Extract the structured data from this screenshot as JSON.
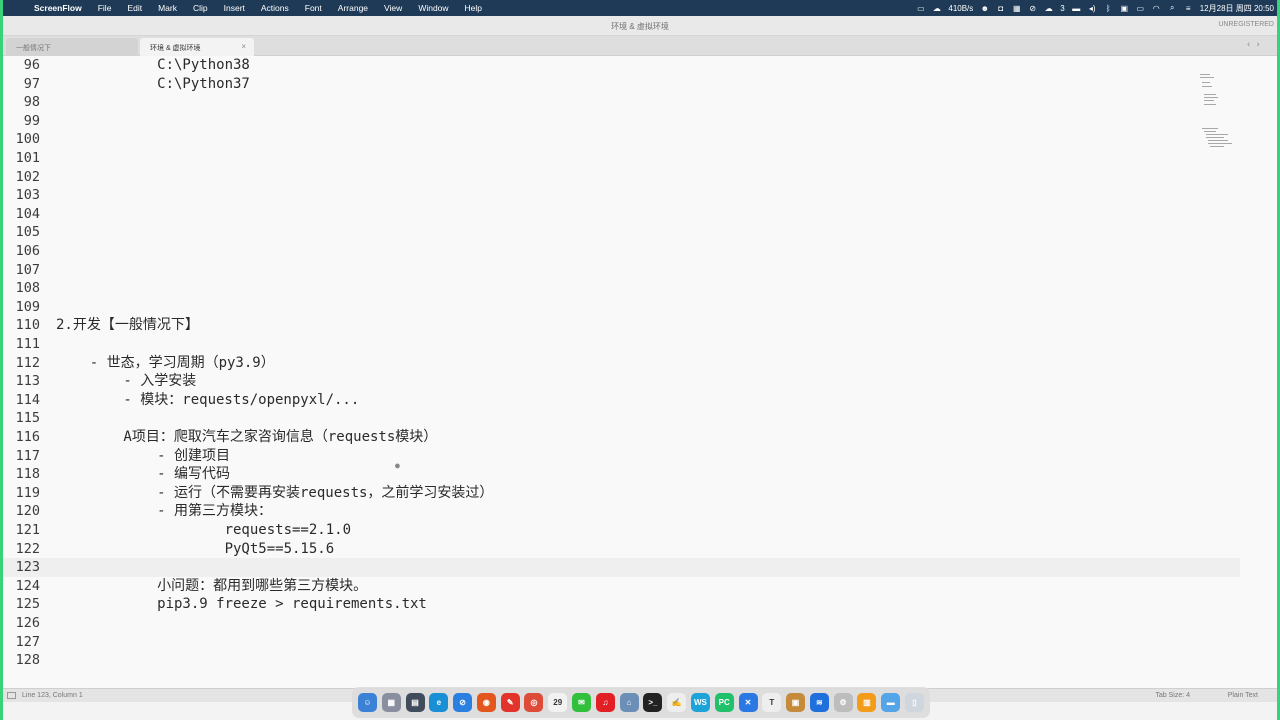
{
  "menubar": {
    "apple": "",
    "items": [
      "ScreenFlow",
      "File",
      "Edit",
      "Mark",
      "Clip",
      "Insert",
      "Actions",
      "Font",
      "Arrange",
      "View",
      "Window",
      "Help"
    ],
    "status": {
      "network": "410B/s",
      "badge_count": "3",
      "datetime": "12月28日 周四 20:50"
    }
  },
  "window": {
    "title": "环境 & 虚拟环境",
    "unregistered": "UNREGISTERED",
    "tabs": [
      {
        "label": "一般情况下",
        "active": false
      },
      {
        "label": "环境 & 虚拟环境",
        "active": true
      }
    ]
  },
  "editor": {
    "current_line": 123,
    "lines": [
      {
        "n": "96",
        "text": "            C:\\Python38"
      },
      {
        "n": "97",
        "text": "            C:\\Python37"
      },
      {
        "n": "98",
        "text": ""
      },
      {
        "n": "99",
        "text": ""
      },
      {
        "n": "100",
        "text": ""
      },
      {
        "n": "101",
        "text": ""
      },
      {
        "n": "102",
        "text": ""
      },
      {
        "n": "103",
        "text": ""
      },
      {
        "n": "104",
        "text": ""
      },
      {
        "n": "105",
        "text": ""
      },
      {
        "n": "106",
        "text": ""
      },
      {
        "n": "107",
        "text": ""
      },
      {
        "n": "108",
        "text": ""
      },
      {
        "n": "109",
        "text": ""
      },
      {
        "n": "110",
        "text": "2.开发【一般情况下】"
      },
      {
        "n": "111",
        "text": ""
      },
      {
        "n": "112",
        "text": "    - 世态，学习周期（py3.9）"
      },
      {
        "n": "113",
        "text": "        - 入学安装"
      },
      {
        "n": "114",
        "text": "        - 模块：requests/openpyxl/..."
      },
      {
        "n": "115",
        "text": ""
      },
      {
        "n": "116",
        "text": "        A项目：爬取汽车之家咨询信息（requests模块）"
      },
      {
        "n": "117",
        "text": "            - 创建项目"
      },
      {
        "n": "118",
        "text": "            - 编写代码"
      },
      {
        "n": "119",
        "text": "            - 运行（不需要再安装requests，之前学习安装过）"
      },
      {
        "n": "120",
        "text": "            - 用第三方模块："
      },
      {
        "n": "121",
        "text": "                    requests==2.1.0"
      },
      {
        "n": "122",
        "text": "                    PyQt5==5.15.6"
      },
      {
        "n": "123",
        "text": ""
      },
      {
        "n": "124",
        "text": "            小问题：都用到哪些第三方模块。"
      },
      {
        "n": "125",
        "text": "            pip3.9 freeze > requirements.txt"
      },
      {
        "n": "126",
        "text": ""
      },
      {
        "n": "127",
        "text": ""
      },
      {
        "n": "128",
        "text": ""
      }
    ]
  },
  "statusbar": {
    "position": "Line 123, Column 1",
    "tab_size": "Tab Size: 4",
    "syntax": "Plain Text"
  },
  "dock": {
    "apps": [
      {
        "name": "finder",
        "color": "#3b82d6",
        "glyph": "☺"
      },
      {
        "name": "launchpad",
        "color": "#8a8fa0",
        "glyph": "▦"
      },
      {
        "name": "mission-control",
        "color": "#404b5c",
        "glyph": "▤"
      },
      {
        "name": "edge",
        "color": "#1b8fd6",
        "glyph": "e"
      },
      {
        "name": "safari",
        "color": "#2a7fe0",
        "glyph": "⊘"
      },
      {
        "name": "firefox",
        "color": "#e3561e",
        "glyph": "◉"
      },
      {
        "name": "app-red",
        "color": "#e2342a",
        "glyph": "✎"
      },
      {
        "name": "chrome",
        "color": "#dd4b39",
        "glyph": "◎"
      },
      {
        "name": "calendar",
        "color": "#f2f2f2",
        "glyph": "29"
      },
      {
        "name": "wechat",
        "color": "#30c03c",
        "glyph": "✉"
      },
      {
        "name": "netease-music",
        "color": "#e11f25",
        "glyph": "♫"
      },
      {
        "name": "preview",
        "color": "#6c8fb7",
        "glyph": "⌂"
      },
      {
        "name": "terminal",
        "color": "#222222",
        "glyph": ">_"
      },
      {
        "name": "textedit",
        "color": "#eeeeee",
        "glyph": "✍"
      },
      {
        "name": "webstorm",
        "color": "#1ea3d9",
        "glyph": "WS"
      },
      {
        "name": "pycharm",
        "color": "#21c06b",
        "glyph": "PC"
      },
      {
        "name": "xcode",
        "color": "#2b78e4",
        "glyph": "✕"
      },
      {
        "name": "typora",
        "color": "#eeeeee",
        "glyph": "T"
      },
      {
        "name": "archive",
        "color": "#c58a3a",
        "glyph": "▣"
      },
      {
        "name": "screenflow",
        "color": "#1f6fdc",
        "glyph": "≋"
      },
      {
        "name": "utility",
        "color": "#bdbdbd",
        "glyph": "⚙"
      },
      {
        "name": "documents",
        "color": "#f39c1a",
        "glyph": "▥"
      },
      {
        "name": "folder",
        "color": "#54a4e8",
        "glyph": "▬"
      },
      {
        "name": "trash",
        "color": "#cfd6dd",
        "glyph": "▯"
      }
    ]
  }
}
